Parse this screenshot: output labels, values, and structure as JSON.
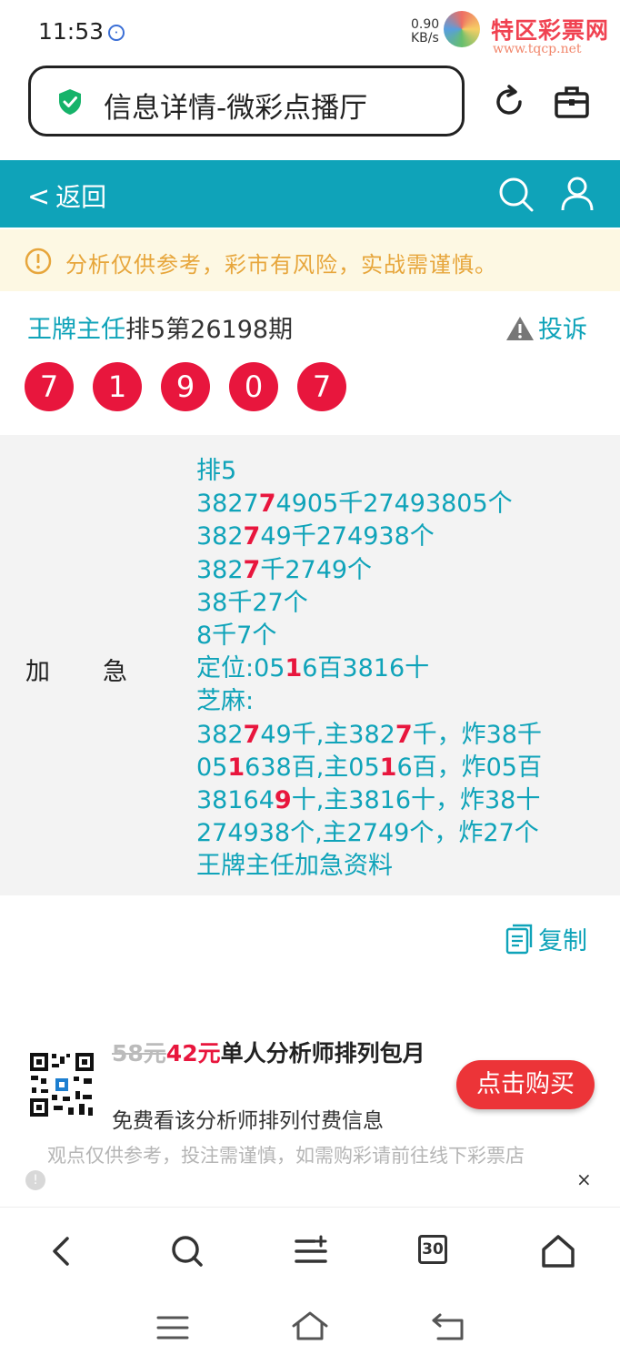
{
  "status_bar": {
    "time": "11:53",
    "speed_value": "0.90",
    "speed_unit": "KB/s"
  },
  "watermark": {
    "name": "特区彩票网",
    "url": "www.tqcp.net"
  },
  "address_bar": {
    "title": "信息详情-微彩点播厅"
  },
  "nav": {
    "back_label": "返回"
  },
  "notice": {
    "text": "分析仅供参考，彩市有风险，实战需谨慎。"
  },
  "post": {
    "author": "王牌主任",
    "issue": "排5第26198期",
    "complain_label": "投诉",
    "balls": [
      "7",
      "1",
      "9",
      "0",
      "7"
    ]
  },
  "content": {
    "label_a": "加",
    "label_b": "急",
    "lines": [
      [
        {
          "t": "排5"
        }
      ],
      [
        {
          "t": "3827",
          "r": false
        },
        {
          "t": "7",
          "r": true
        },
        {
          "t": "4905千27493805个",
          "r": false
        }
      ],
      [
        {
          "t": "382"
        },
        {
          "t": "7",
          "r": true
        },
        {
          "t": "49千274938个"
        }
      ],
      [
        {
          "t": "382"
        },
        {
          "t": "7",
          "r": true
        },
        {
          "t": "千2749个"
        }
      ],
      [
        {
          "t": "38千27个"
        }
      ],
      [
        {
          "t": "8千7个"
        }
      ],
      [
        {
          "t": "定位:05"
        },
        {
          "t": "1",
          "r": true
        },
        {
          "t": "6百3816十"
        }
      ],
      [
        {
          "t": "芝麻:"
        }
      ],
      [
        {
          "t": "382"
        },
        {
          "t": "7",
          "r": true
        },
        {
          "t": "49千,主382"
        },
        {
          "t": "7",
          "r": true
        },
        {
          "t": "千，炸38千"
        }
      ],
      [
        {
          "t": "05"
        },
        {
          "t": "1",
          "r": true
        },
        {
          "t": "638百,主05"
        },
        {
          "t": "1",
          "r": true
        },
        {
          "t": "6百，炸05百"
        }
      ],
      [
        {
          "t": "38164"
        },
        {
          "t": "9",
          "r": true
        },
        {
          "t": "十,主3816十，炸38十"
        }
      ],
      [
        {
          "t": "274938个,主2749个，炸27个"
        }
      ],
      [
        {
          "t": "王牌主任加急资料"
        }
      ]
    ]
  },
  "copy_label": "复制",
  "promo": {
    "old_price": "58元",
    "new_price": "42元",
    "title": "单人分析师排列包月",
    "subtitle": "免费看该分析师排列付费信息",
    "buy_label": "点击购买",
    "disclaimer": "观点仅供参考，投注需谨慎，如需购彩请前往线下彩票店",
    "close": "×"
  },
  "toolbar": {
    "tab_count": "30"
  },
  "colors": {
    "teal": "#0fa3b9",
    "red": "#e8163d",
    "notice_text": "#e7a63c",
    "notice_bg": "#fdf8e3"
  }
}
